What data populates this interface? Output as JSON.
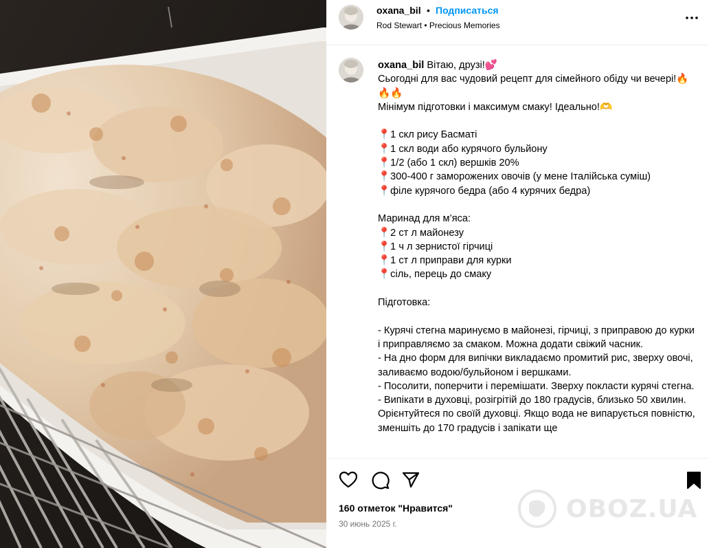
{
  "post": {
    "username": "oxana_bil",
    "separator": "•",
    "follow_label": "Подписаться",
    "song": "Rod Stewart • Precious Memories"
  },
  "caption": {
    "username": "oxana_bil",
    "text": "Вітаю, друзі!💕\nСьогодні для вас чудовий рецепт для сімейного обіду чи вечері!🔥🔥🔥\nМінімум підготовки і максимум смаку! Ідеально!🫶\n\n📍1 скл рису Басматі\n📍1 скл води або курячого бульйону\n📍1/2 (або 1 скл) вершків 20%\n📍300-400 г заморожених овочів (у мене Італійська суміш)\n📍філе курячого бедра (або 4 курячих бедра)\n\nМаринад для м’яса:\n📍2 ст л майонезу\n📍1 ч л зернистої гірчиці\n📍1 ст л приправи для курки\n📍сіль, перець до смаку\n\nПідготовка:\n\n- Курячі стегна маринуємо в майонезі, гірчиці, з приправою до курки і приправляємо за смаком. Можна додати свіжий часник.\n- На дно форм для випічки викладаємо промитий рис, зверху овочі, заливаємо водою/бульйоном і вершками.\n- Посолити, поперчити і перемішати. Зверху покласти курячі стегна.\n- Випікати в духовці, розігрітій до 180 градусів, близько 50 хвилин. Орієнтуйтеся по своїй духовці. Якщо вода не випарується повністю, зменшіть до 170 градусів і запікати ще"
  },
  "footer": {
    "likes": "160 отметок \"Нравится\"",
    "date": "30 июнь 2025 г."
  },
  "watermark": {
    "text": "OBOZ.UA"
  },
  "icons": {
    "like": "heart-icon",
    "comment": "comment-icon",
    "share": "paper-plane-icon",
    "save": "bookmark-icon",
    "more": "more-horizontal-icon"
  },
  "colors": {
    "link_blue": "#0095f6",
    "secondary_text": "#737373",
    "divider": "#efefef"
  }
}
